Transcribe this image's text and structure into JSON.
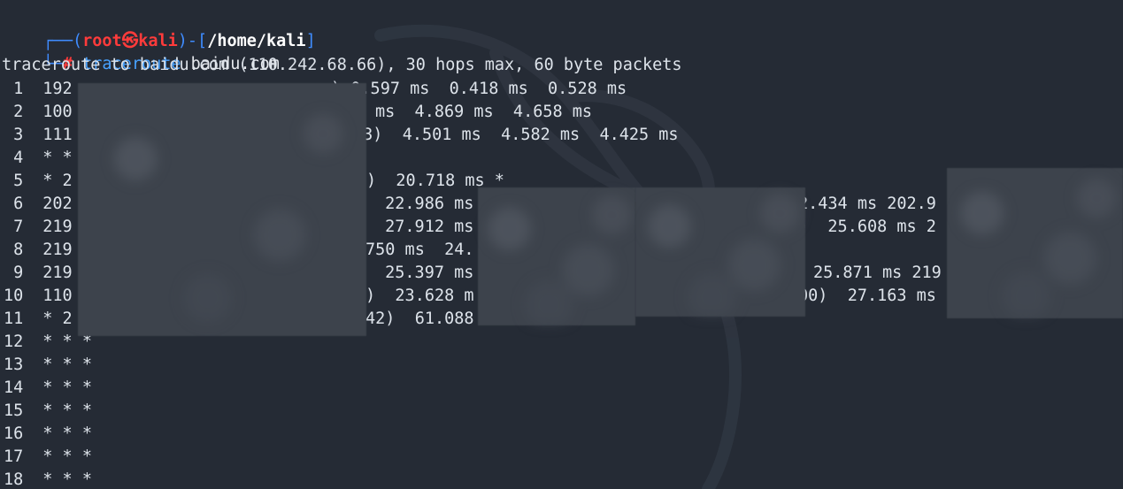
{
  "prompt": {
    "bar_top": "┌──(",
    "user_host_user": "root",
    "user_host_sep": "㉿",
    "user_host_host": "kali",
    "mid": ")-[",
    "path": "/home/kali",
    "end": "]",
    "bar_bottom": "└─",
    "hash": "#",
    "command": "traceroute",
    "argument": " baidu.com"
  },
  "header": "traceroute to baidu.com (110.242.68.66), 30 hops max, 60 byte packets",
  "hops": [
    {
      "num": " 1",
      "left": "  192",
      "mid": ") 0.597 ms  0.418 ms  0.528 ms",
      "right": ""
    },
    {
      "num": " 2",
      "left": "  100",
      "mid": "ms  4.869 ms  4.658 ms",
      "right": ""
    },
    {
      "num": " 3",
      "left": "  111",
      "mid": "53)  4.501 ms  4.582 ms  4.425 ms",
      "right": ""
    },
    {
      "num": " 4",
      "left": "  * *",
      "mid": "",
      "right": ""
    },
    {
      "num": " 5",
      "left": "  * 2",
      "mid": ")  20.718 ms *",
      "right": ""
    },
    {
      "num": " 6",
      "left": "  202",
      "mid": " 22.986 ms",
      "right": "2.434 ms 202.9"
    },
    {
      "num": " 7",
      "left": "  219",
      "mid": " 27.912 ms",
      "right": ")  25.608 ms 2"
    },
    {
      "num": " 8",
      "left": "  219",
      "mid": "750 ms  24.",
      "right": ""
    },
    {
      "num": " 9",
      "left": "  219",
      "mid": " 25.397 ms",
      "right": "25.871 ms 219"
    },
    {
      "num": "10",
      "left": "  110",
      "mid": ")  23.628 m",
      "right": "00)  27.163 ms"
    },
    {
      "num": "11",
      "left": "  * 2",
      "mid": "42)  61.088",
      "right": ""
    },
    {
      "num": "12",
      "left": "  * * *",
      "mid": "",
      "right": ""
    },
    {
      "num": "13",
      "left": "  * * *",
      "mid": "",
      "right": ""
    },
    {
      "num": "14",
      "left": "  * * *",
      "mid": "",
      "right": ""
    },
    {
      "num": "15",
      "left": "  * * *",
      "mid": "",
      "right": ""
    },
    {
      "num": "16",
      "left": "  * * *",
      "mid": "",
      "right": ""
    },
    {
      "num": "17",
      "left": "  * * *",
      "mid": "",
      "right": ""
    },
    {
      "num": "18",
      "left": "  * * *",
      "mid": "",
      "right": ""
    }
  ],
  "colors": {
    "background": "#252b35",
    "prompt_bar": "#3f8cff",
    "prompt_user": "#ff3b3b",
    "command": "#48a2ff",
    "text": "#dde3ea"
  }
}
